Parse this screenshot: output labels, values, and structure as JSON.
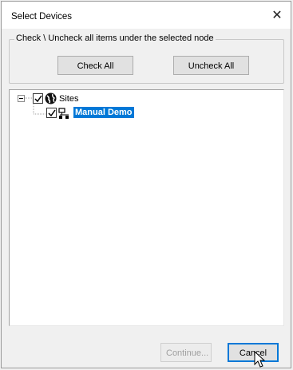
{
  "window": {
    "title": "Select Devices",
    "close_glyph": "✕"
  },
  "group": {
    "label": "Check \\ Uncheck all items under the selected node",
    "check_all": "Check All",
    "uncheck_all": "Uncheck All"
  },
  "tree": {
    "root": {
      "label": "Sites",
      "checked": true,
      "expanded": true,
      "icon": "globe-icon"
    },
    "children": [
      {
        "label": "Manual Demo",
        "checked": true,
        "selected": true,
        "icon": "network-icon"
      }
    ]
  },
  "footer": {
    "continue": "Continue...",
    "cancel": "Cancel"
  },
  "colors": {
    "selection": "#0078d7",
    "button_face": "#e1e1e1"
  }
}
